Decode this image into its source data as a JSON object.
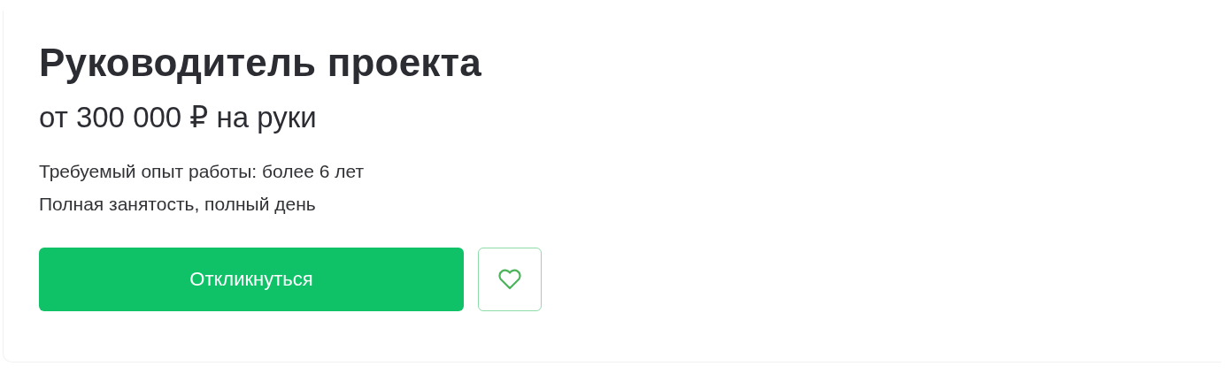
{
  "vacancy": {
    "title": "Руководитель проекта",
    "salary": "от 300 000 ₽ на руки",
    "details": [
      "Требуемый опыт работы: более 6 лет",
      "Полная занятость, полный день"
    ],
    "apply_button": "Откликнуться"
  }
}
